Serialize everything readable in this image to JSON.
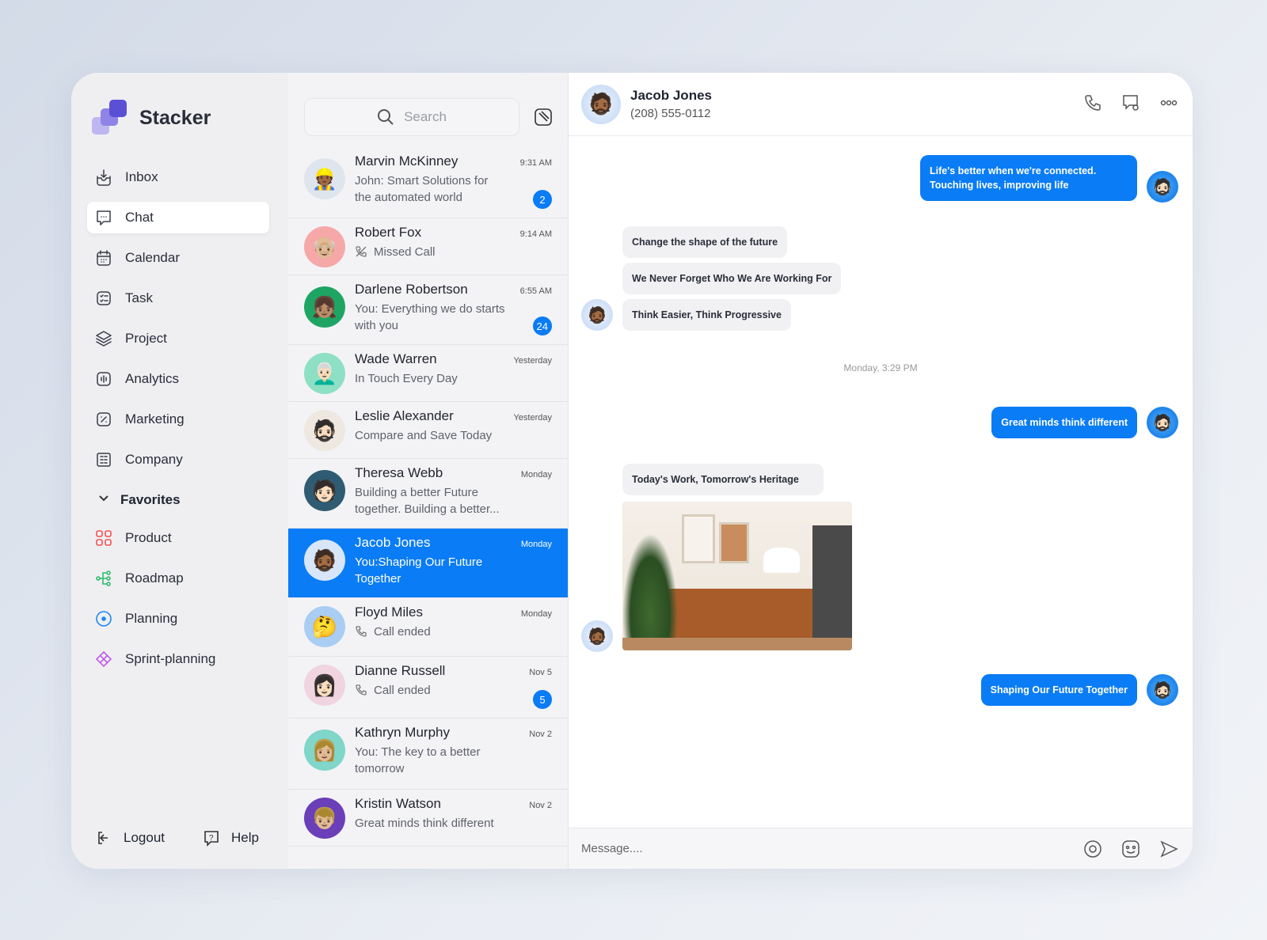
{
  "app": {
    "name": "Stacker"
  },
  "sidebar": {
    "items": [
      {
        "label": "Inbox",
        "icon": "inbox-icon"
      },
      {
        "label": "Chat",
        "icon": "chat-icon",
        "active": true
      },
      {
        "label": "Calendar",
        "icon": "calendar-icon"
      },
      {
        "label": "Task",
        "icon": "task-icon"
      },
      {
        "label": "Project",
        "icon": "layers-icon"
      },
      {
        "label": "Analytics",
        "icon": "analytics-icon"
      },
      {
        "label": "Marketing",
        "icon": "percent-icon"
      },
      {
        "label": "Company",
        "icon": "building-icon"
      }
    ],
    "favorites_label": "Favorites",
    "favorites": [
      {
        "label": "Product",
        "color": "#f0544f"
      },
      {
        "label": "Roadmap",
        "color": "#2ebd6b"
      },
      {
        "label": "Planning",
        "color": "#1e88f0"
      },
      {
        "label": "Sprint-planning",
        "color": "#c25ae8"
      }
    ],
    "logout": "Logout",
    "help": "Help"
  },
  "search": {
    "placeholder": "Search"
  },
  "conversations": [
    {
      "name": "Marvin McKinney",
      "preview": "John: Smart Solutions for the automated world",
      "time": "9:31 AM",
      "badge": "2"
    },
    {
      "name": "Robert Fox",
      "preview": "Missed Call",
      "time": "9:14 AM",
      "call": "missed"
    },
    {
      "name": "Darlene Robertson",
      "preview": "You: Everything we do starts with you",
      "time": "6:55 AM",
      "badge": "24"
    },
    {
      "name": "Wade Warren",
      "preview": "In Touch Every Day",
      "time": "Yesterday"
    },
    {
      "name": "Leslie Alexander",
      "preview": "Compare and Save Today",
      "time": "Yesterday"
    },
    {
      "name": "Theresa Webb",
      "preview": "Building a better Future together. Building a better...",
      "time": "Monday"
    },
    {
      "name": "Jacob Jones",
      "preview": "You:Shaping Our Future Together",
      "time": "Monday",
      "selected": true
    },
    {
      "name": "Floyd Miles",
      "preview": "Call ended",
      "time": "Monday",
      "call": "ended"
    },
    {
      "name": "Dianne Russell",
      "preview": "Call ended",
      "time": "Nov 5",
      "call": "ended",
      "badge": "5"
    },
    {
      "name": "Kathryn Murphy",
      "preview": "You: The key to a better tomorrow",
      "time": "Nov 2"
    },
    {
      "name": "Kristin Watson",
      "preview": "Great minds think different",
      "time": "Nov 2"
    }
  ],
  "chat": {
    "name": "Jacob Jones",
    "phone": "(208) 555-0112",
    "messages": [
      {
        "text": "Life's better when we're connected. Touching lives, improving life",
        "dir": "out"
      },
      {
        "text": "Change the shape of the future",
        "dir": "in"
      },
      {
        "text": "We Never Forget Who We Are Working For",
        "dir": "in"
      },
      {
        "text": "Think Easier, Think Progressive",
        "dir": "in"
      },
      {
        "text": "Great minds think different",
        "dir": "out"
      },
      {
        "text": "Today's Work, Tomorrow's Heritage",
        "dir": "in"
      },
      {
        "text": "Shaping Our Future Together",
        "dir": "out"
      }
    ],
    "timestamp": "Monday, 3:29 PM",
    "composer_placeholder": "Message...."
  },
  "colors": {
    "accent": "#0a7cf5",
    "logo": "#5b4fd6"
  }
}
